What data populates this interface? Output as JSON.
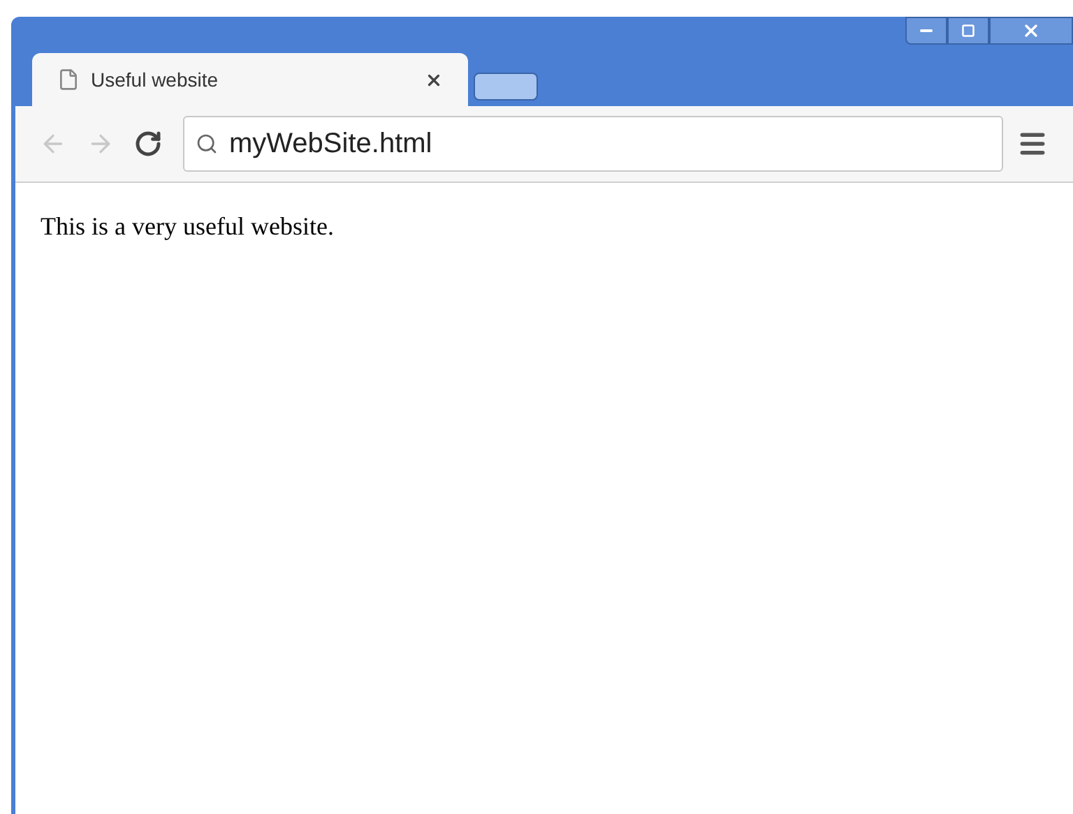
{
  "tabs": [
    {
      "title": "Useful website",
      "selected": true
    }
  ],
  "toolbar": {
    "back": {
      "disabled": true
    },
    "forward": {
      "disabled": true
    },
    "address": "myWebSite.html"
  },
  "page": {
    "text": "This is a very useful website."
  }
}
